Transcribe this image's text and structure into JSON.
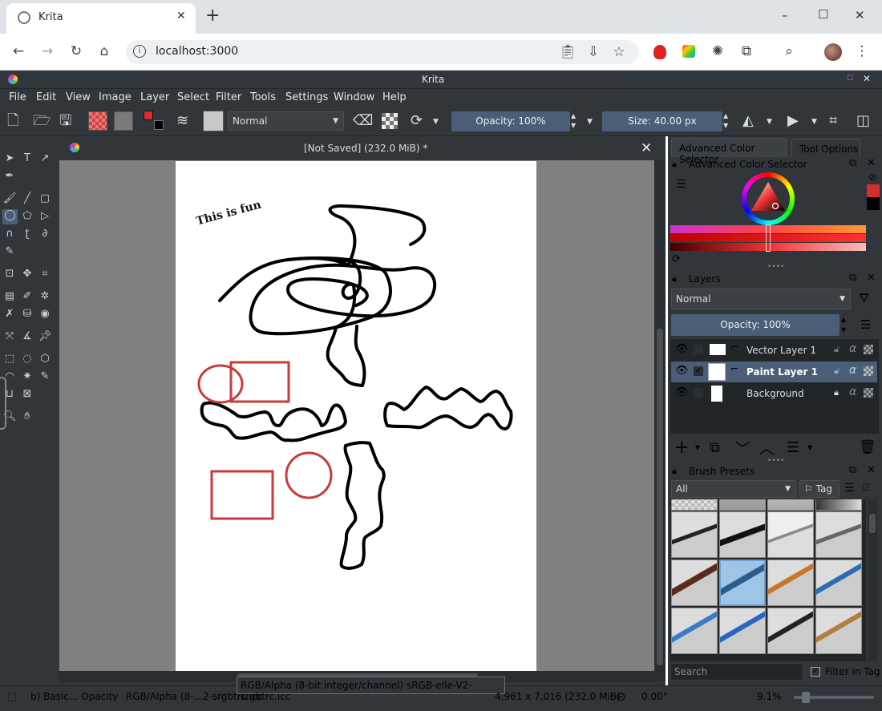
{
  "browser": {
    "tab_title": "Krita",
    "new_tab": "+",
    "url": "localhost:3000",
    "window_controls": {
      "minimize": "–",
      "maximize": "☐",
      "close": "✕"
    }
  },
  "app": {
    "title": "Krita",
    "menu": [
      "File",
      "Edit",
      "View",
      "Image",
      "Layer",
      "Select",
      "Filter",
      "Tools",
      "Settings",
      "Window",
      "Help"
    ],
    "toolbar": {
      "blend_mode": "Normal",
      "opacity_label": "Opacity: 100%",
      "size_label": "Size: 40.00 px"
    },
    "document": {
      "title": "[Not Saved]  (232.0 MiB) *",
      "canvas_text": "This is fun"
    },
    "dockers": {
      "tabs": [
        "Advanced Color Selector",
        "Tool Options"
      ],
      "color_selector_title": "Advanced Color Selector",
      "layers_title": "Layers",
      "layer_blend": "Normal",
      "layer_opacity": "Opacity:  100%",
      "layers": [
        {
          "name": "Vector Layer 1",
          "selected": false,
          "locked": false
        },
        {
          "name": "Paint Layer 1",
          "selected": true,
          "locked": false
        },
        {
          "name": "Background",
          "selected": false,
          "locked": true
        }
      ],
      "brush_presets_title": "Brush Presets",
      "brush_filter": "All",
      "tag_label": "Tag",
      "search_placeholder": "Search",
      "filter_in_tag": "Filter in Tag"
    },
    "status": {
      "brush": "b) Basic... Opacity",
      "colorspace": "RGB/Alpha (8-...2-srgbtrc.icc",
      "tooltip": "RGB/Alpha (8-bit integer/channel)  sRGB-elle-V2-srgbtrc.icc",
      "dimensions": "4,961 x 7,016 (232.0 MiB)",
      "rotation": "0.00°",
      "zoom": "9.1%"
    }
  }
}
